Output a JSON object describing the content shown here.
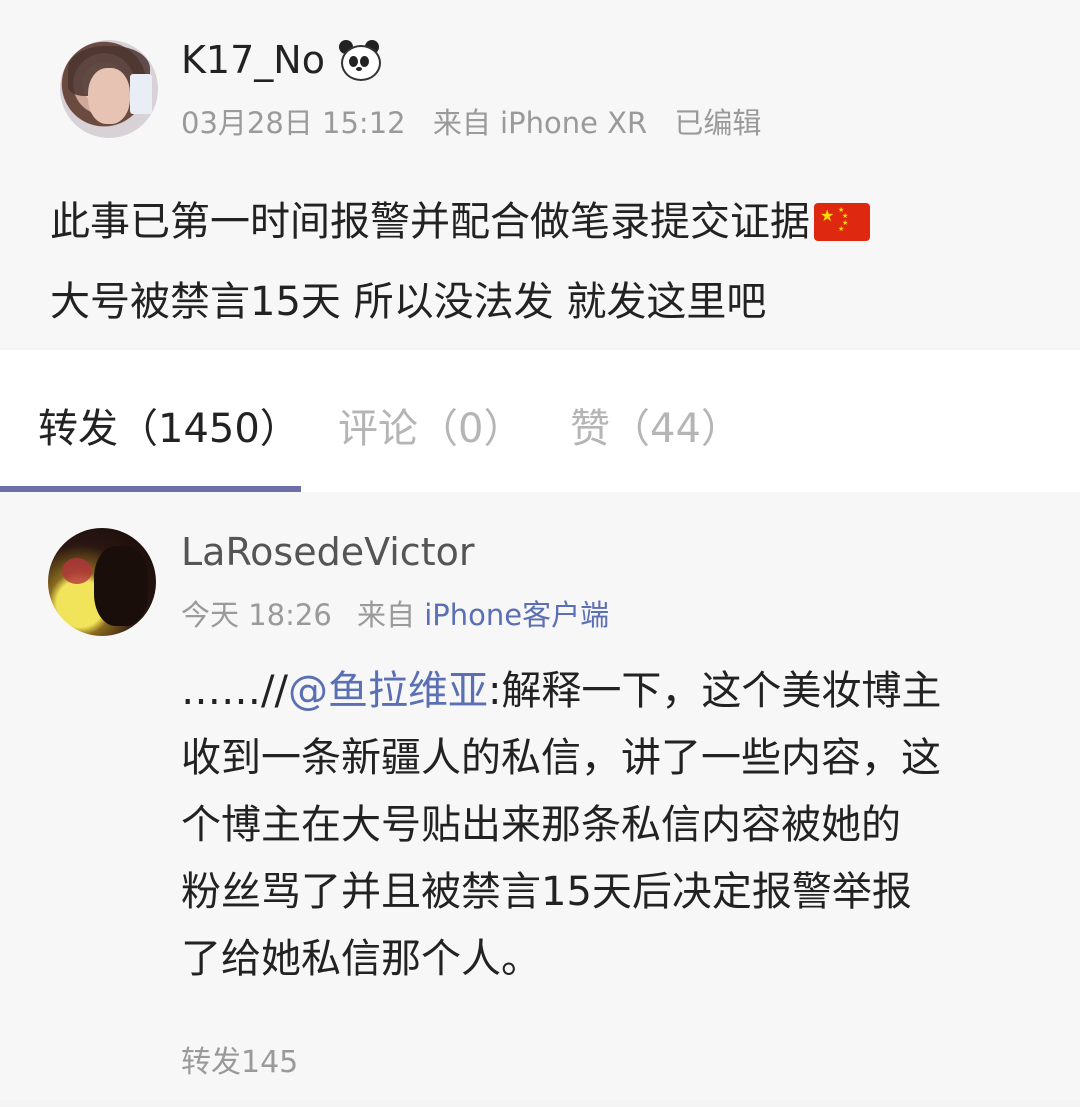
{
  "post": {
    "username": "K17_No",
    "username_emoji": "panda-icon",
    "date": "03月28日 15:12",
    "source": "来自 iPhone XR",
    "edited": "已编辑",
    "text_line1": "此事已第一时间报警并配合做笔录提交证据",
    "text_line1_emoji": "china-flag-icon",
    "text_line2": "大号被禁言15天 所以没法发 就发这里吧"
  },
  "tabs": {
    "repost": "转发（1450）",
    "comments": "评论（0）",
    "likes": "赞（44）"
  },
  "repost": {
    "username": "LaRosedeVictor",
    "time": "今天 18:26",
    "source_prefix": "来自",
    "source_link": "iPhone客户端",
    "text_prefix": "……//",
    "mention": "@鱼拉维亚",
    "text_line1_rest": ":解释一下，这个美妆博主",
    "text_line2": "收到一条新疆人的私信，讲了一些内容，这",
    "text_line3": "个博主在大号贴出来那条私信内容被她的",
    "text_line4": "粉丝骂了并且被禁言15天后决定报警举报",
    "text_line5": "了给她私信那个人。",
    "repost_count": "转发145"
  },
  "colors": {
    "link": "#5a6fb4",
    "tab_indicator": "#6f6fa8",
    "muted": "#9a9a9a"
  }
}
